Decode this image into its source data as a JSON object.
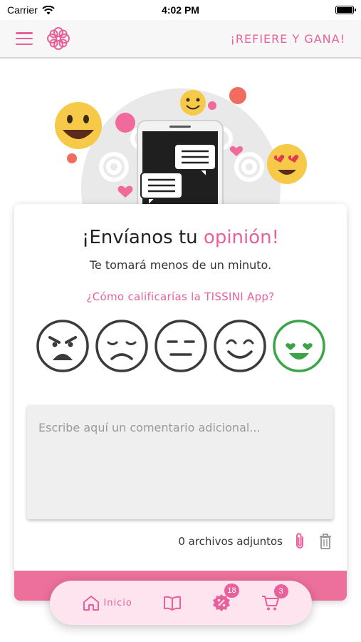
{
  "status_bar": {
    "carrier": "Carrier",
    "time": "4:02 PM"
  },
  "header": {
    "refer_label": "¡REFIERE Y GANA!",
    "icons": [
      "menu-icon",
      "brand-logo"
    ]
  },
  "feedback": {
    "title_prefix": "¡Envíanos tu ",
    "title_accent": "opinión!",
    "subtitle": "Te tomará menos de un minuto.",
    "question": "¿Cómo calificarías la TISSINI App?",
    "ratings": [
      {
        "name": "angry",
        "selected": false
      },
      {
        "name": "sad",
        "selected": false
      },
      {
        "name": "neutral",
        "selected": false
      },
      {
        "name": "happy",
        "selected": false
      },
      {
        "name": "love",
        "selected": true
      }
    ],
    "comment_placeholder": "Escribe aquí un comentario adicional...",
    "attachments_label": "0 archivos adjuntos"
  },
  "bottom_nav": {
    "items": [
      {
        "label": "Inicio",
        "icon": "home-icon"
      },
      {
        "label": "",
        "icon": "catalog-icon"
      },
      {
        "label": "",
        "icon": "promo-icon",
        "badge": "18"
      },
      {
        "label": "",
        "icon": "cart-icon",
        "badge": "3"
      }
    ]
  },
  "colors": {
    "accent": "#e8619a",
    "selected_face": "#3aa447",
    "face_default": "#3b3b3b"
  }
}
